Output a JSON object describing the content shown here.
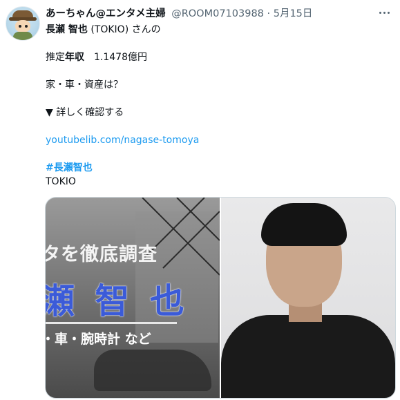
{
  "tweet": {
    "author_name": "あーちゃん@エンタメ主婦",
    "handle": "@ROOM07103988",
    "separator": "·",
    "date": "5月15日",
    "lines": {
      "line1_bold": "長瀬 智也",
      "line1_rest": " (TOKIO) さんの",
      "line2_label": "推定",
      "line2_bold": "年収",
      "line2_value": "　1.1478億円",
      "line3": "家・車・資産は？",
      "line4": "▼ 詳しく確認する",
      "link": "youtubelib.com/nagase-tomoya",
      "hashtag": "#長瀬智也",
      "last": "TOKIO"
    },
    "media": {
      "promo_top": "タを徹底調査",
      "promo_name": "瀬 智 也",
      "promo_sub": "・車・腕時計 など"
    }
  }
}
